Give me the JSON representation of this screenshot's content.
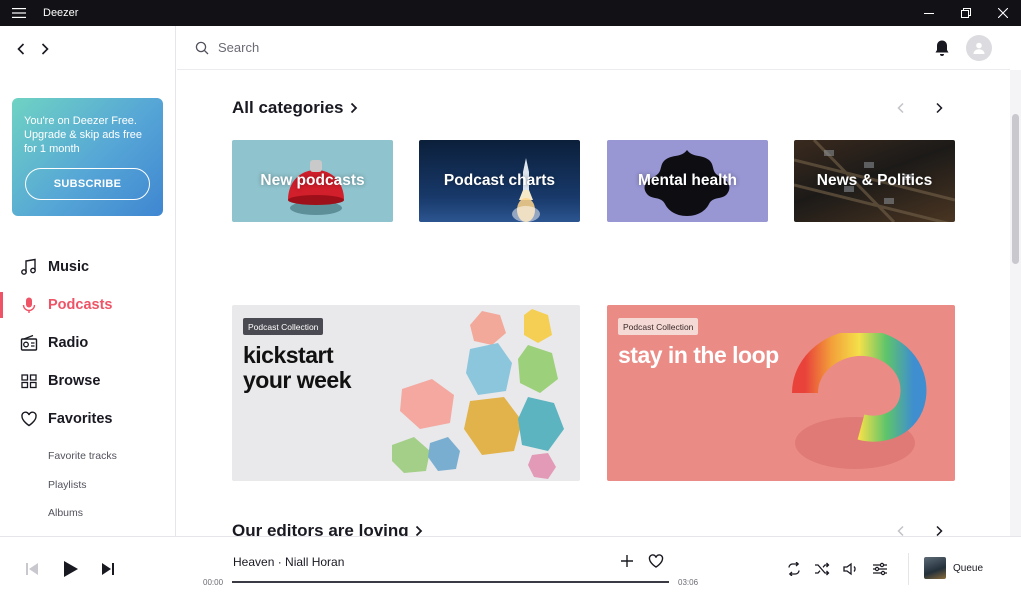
{
  "window": {
    "title": "Deezer"
  },
  "promo": {
    "text": "You're on Deezer Free. Upgrade & skip ads free for 1 month",
    "button": "SUBSCRIBE"
  },
  "menu": {
    "items": [
      {
        "label": "Music",
        "icon": "music-note-icon"
      },
      {
        "label": "Podcasts",
        "icon": "microphone-icon",
        "active": true
      },
      {
        "label": "Radio",
        "icon": "radio-icon"
      },
      {
        "label": "Browse",
        "icon": "grid-icon"
      },
      {
        "label": "Favorites",
        "icon": "heart-icon"
      }
    ],
    "sub_items": [
      "Favorite tracks",
      "Playlists",
      "Albums"
    ]
  },
  "search": {
    "placeholder": "Search"
  },
  "categories": {
    "title": "All categories",
    "tiles": [
      "New podcasts",
      "Podcast charts",
      "Mental health",
      "News & Politics"
    ]
  },
  "collections": [
    {
      "badge": "Podcast Collection",
      "title_line1": "kickstart",
      "title_line2": "your week"
    },
    {
      "badge": "Podcast Collection",
      "title_line1": "stay in the loop"
    }
  ],
  "editors": {
    "title": "Our editors are loving"
  },
  "player": {
    "track": "Heaven · Niall Horan",
    "elapsed": "00:00",
    "duration": "03:06",
    "progress_fraction": 0,
    "queue_label": "Queue"
  },
  "colors": {
    "accent": "#ef5466",
    "titlebar": "#111116"
  }
}
